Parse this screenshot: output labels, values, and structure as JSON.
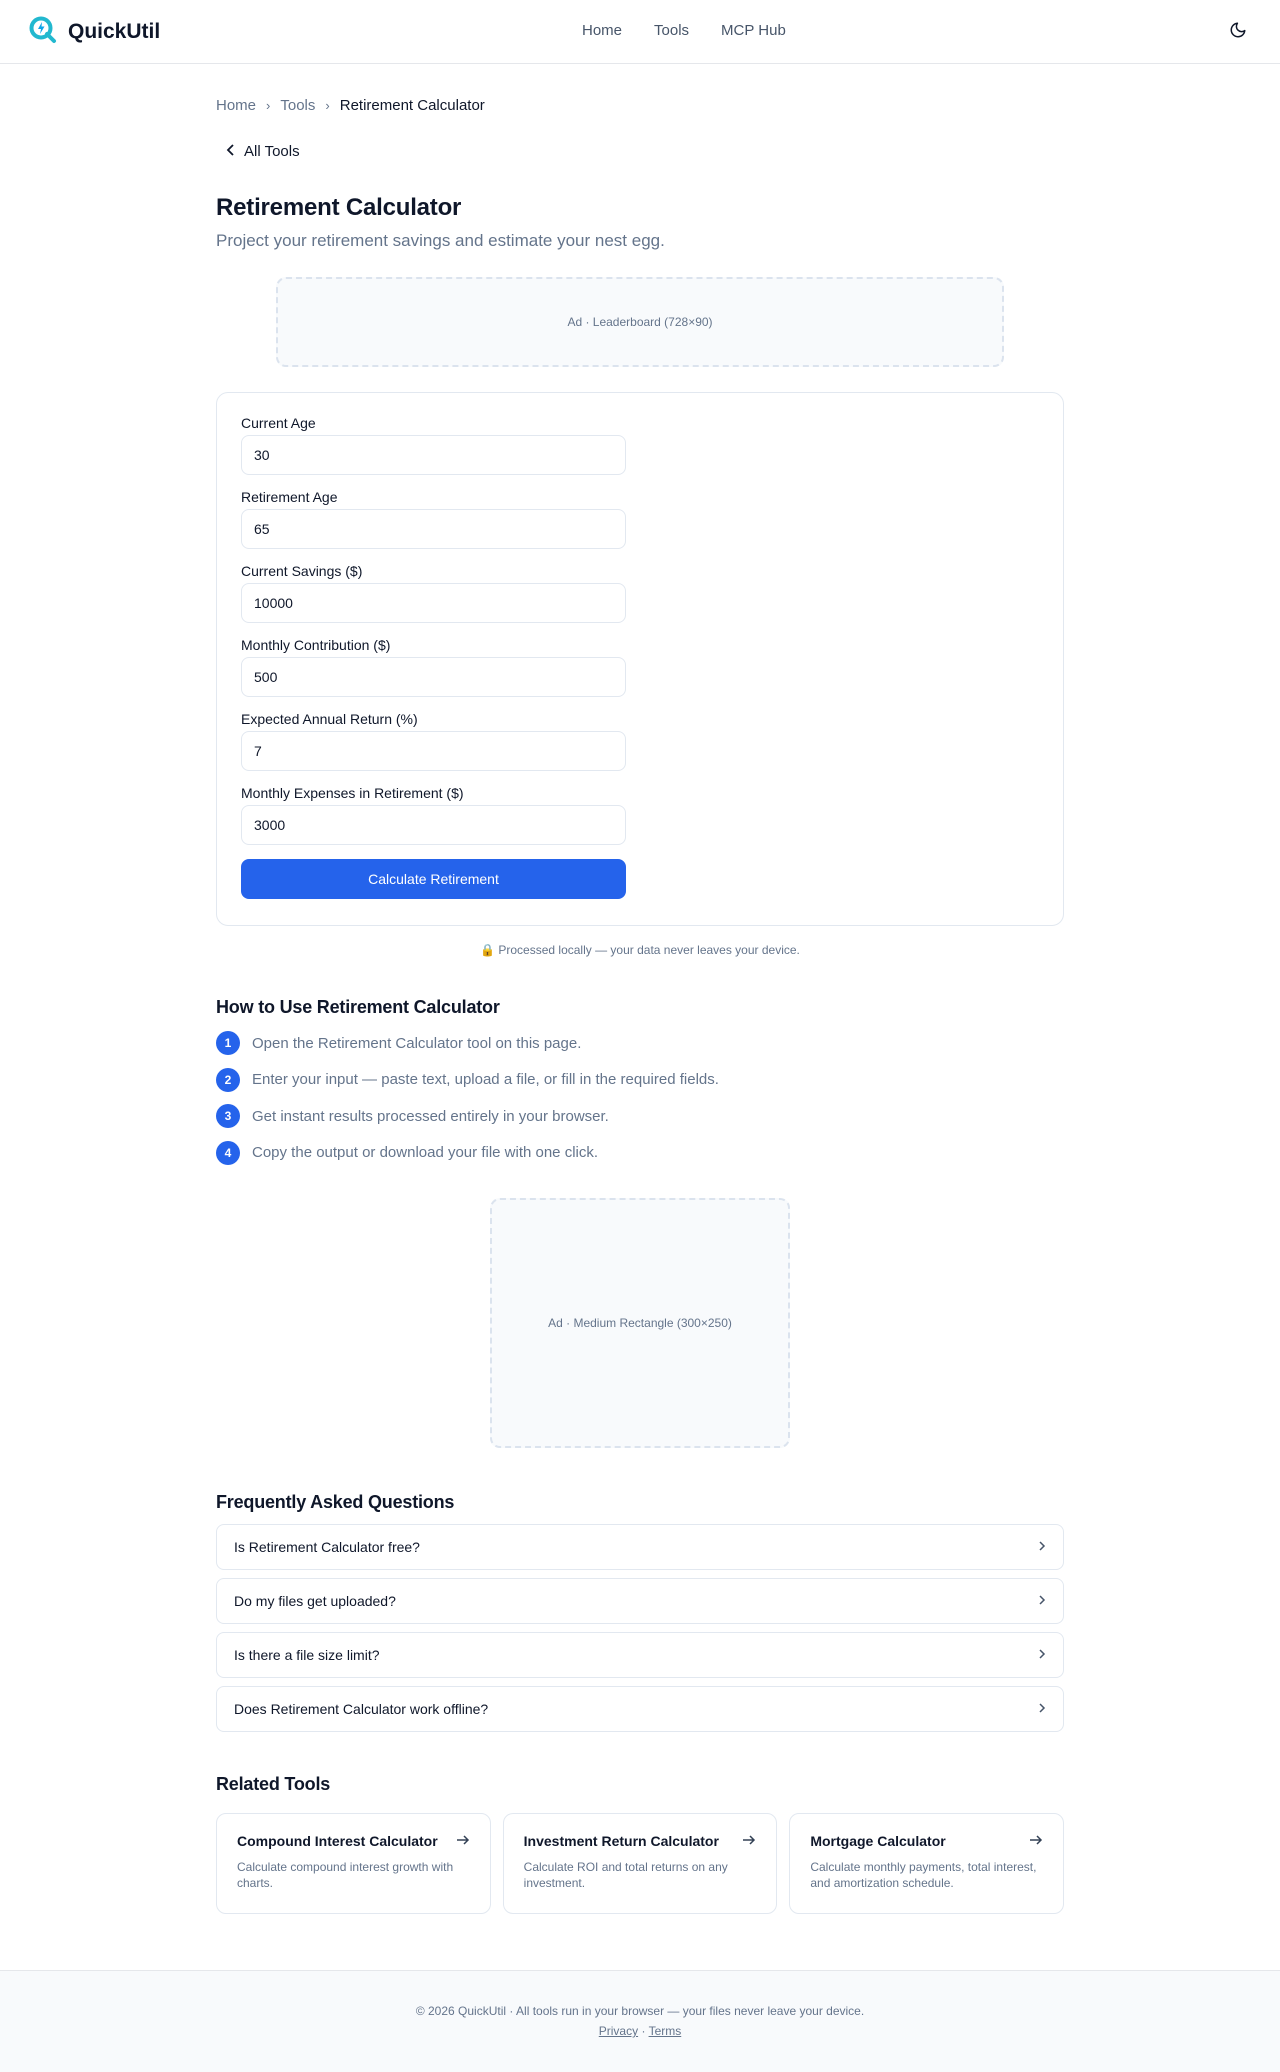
{
  "header": {
    "brand": "QuickUtil",
    "nav": [
      "Home",
      "Tools",
      "MCP Hub"
    ]
  },
  "breadcrumb": [
    "Home",
    "Tools",
    "Retirement Calculator"
  ],
  "back_link": "All Tools",
  "page": {
    "title": "Retirement Calculator",
    "subtitle": "Project your retirement savings and estimate your nest egg."
  },
  "ads": {
    "leaderboard": "Ad · Leaderboard (728×90)",
    "rectangle": "Ad · Medium Rectangle (300×250)"
  },
  "form": {
    "fields": [
      {
        "label": "Current Age",
        "value": "30"
      },
      {
        "label": "Retirement Age",
        "value": "65"
      },
      {
        "label": "Current Savings ($)",
        "value": "10000"
      },
      {
        "label": "Monthly Contribution ($)",
        "value": "500"
      },
      {
        "label": "Expected Annual Return (%)",
        "value": "7"
      },
      {
        "label": "Monthly Expenses in Retirement ($)",
        "value": "3000"
      }
    ],
    "submit": "Calculate Retirement"
  },
  "privacy_note": "🔒 Processed locally — your data never leaves your device.",
  "howto": {
    "title": "How to Use Retirement Calculator",
    "steps": [
      "Open the Retirement Calculator tool on this page.",
      "Enter your input — paste text, upload a file, or fill in the required fields.",
      "Get instant results processed entirely in your browser.",
      "Copy the output or download your file with one click."
    ]
  },
  "faq": {
    "title": "Frequently Asked Questions",
    "items": [
      "Is Retirement Calculator free?",
      "Do my files get uploaded?",
      "Is there a file size limit?",
      "Does Retirement Calculator work offline?"
    ]
  },
  "related": {
    "title": "Related Tools",
    "items": [
      {
        "title": "Compound Interest Calculator",
        "desc": "Calculate compound interest growth with charts."
      },
      {
        "title": "Investment Return Calculator",
        "desc": "Calculate ROI and total returns on any investment."
      },
      {
        "title": "Mortgage Calculator",
        "desc": "Calculate monthly payments, total interest, and amortization schedule."
      }
    ]
  },
  "footer": {
    "text": "© 2026 QuickUtil · All tools run in your browser — your files never leave your device.",
    "links": [
      "Privacy",
      "Terms"
    ],
    "separator": "·"
  },
  "colors": {
    "accent": "#2563eb",
    "logo": "#22b8cf"
  }
}
